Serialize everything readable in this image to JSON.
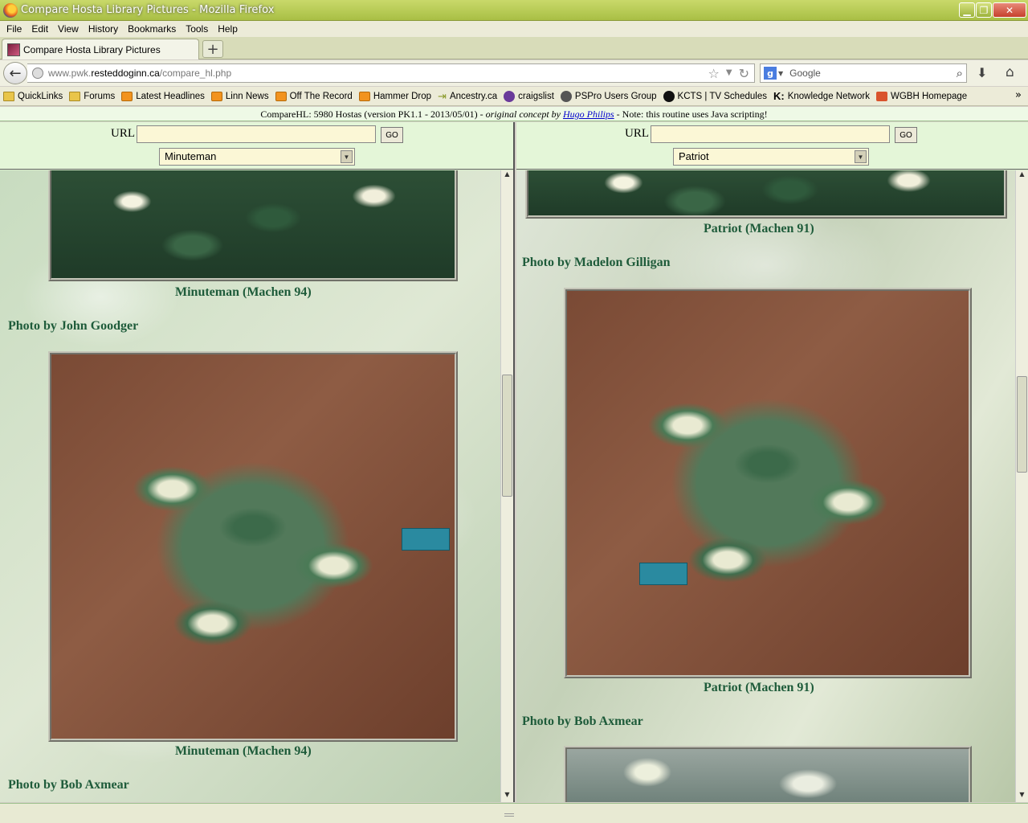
{
  "window": {
    "title": "Compare Hosta Library Pictures - Mozilla Firefox",
    "buttons": {
      "minimize": "▁",
      "maximize": "❐",
      "close": "✕"
    }
  },
  "menu": [
    {
      "label": "File",
      "key": "F"
    },
    {
      "label": "Edit",
      "key": "E"
    },
    {
      "label": "View",
      "key": "V"
    },
    {
      "label": "History",
      "key": "H"
    },
    {
      "label": "Bookmarks",
      "key": "B"
    },
    {
      "label": "Tools",
      "key": "T"
    },
    {
      "label": "Help",
      "key": "H"
    }
  ],
  "tab": {
    "label": "Compare Hosta Library Pictures",
    "new_tab": "+"
  },
  "nav": {
    "back": "←",
    "url_prefix": "www.pwk.",
    "url_domain": "resteddoginn.ca",
    "url_path": "/compare_hl.php",
    "search_placeholder": "Google",
    "search_engine": "g"
  },
  "bookmarks": [
    {
      "label": "QuickLinks",
      "icon": "folder-icon"
    },
    {
      "label": "Forums",
      "icon": "folder-icon"
    },
    {
      "label": "Latest Headlines",
      "icon": "rss-icon"
    },
    {
      "label": "Linn News",
      "icon": "rss-icon"
    },
    {
      "label": "Off The Record",
      "icon": "rss-icon"
    },
    {
      "label": "Hammer Drop",
      "icon": "rss-icon"
    },
    {
      "label": "Ancestry.ca",
      "icon": "arrow-icon"
    },
    {
      "label": "craigslist",
      "icon": "peace-icon"
    },
    {
      "label": "PSPro Users Group",
      "icon": "pspro-icon"
    },
    {
      "label": "KCTS | TV Schedules",
      "icon": "kcts-icon"
    },
    {
      "label": "Knowledge Network",
      "icon": "k-icon"
    },
    {
      "label": "WGBH Homepage",
      "icon": "wgbh-icon"
    }
  ],
  "bookmarks_more": "»",
  "notice": {
    "prefix": "CompareHL: 5980 Hostas (version PK1.1 - 2013/05/01) - ",
    "concept": "original concept by",
    "author": "Hugo Philips",
    "suffix": " - Note: this routine uses Java scripting!"
  },
  "left": {
    "url_label": "URL",
    "url_value": "",
    "go_label": "GO",
    "selected": "Minuteman",
    "captions": {
      "photo1_name": "Minuteman (Machen 94)",
      "photo2_credit": "Photo by John Goodger",
      "photo2_name": "Minuteman (Machen 94)",
      "photo3_credit": "Photo by Bob Axmear"
    }
  },
  "right": {
    "url_label": "URL",
    "url_value": "",
    "go_label": "GO",
    "selected": "Patriot",
    "captions": {
      "photo1_name": "Patriot (Machen 91)",
      "photo2_credit": "Photo by Madelon Gilligan",
      "photo2_name": "Patriot (Machen 91)",
      "photo3_credit": "Photo by Bob Axmear"
    }
  }
}
